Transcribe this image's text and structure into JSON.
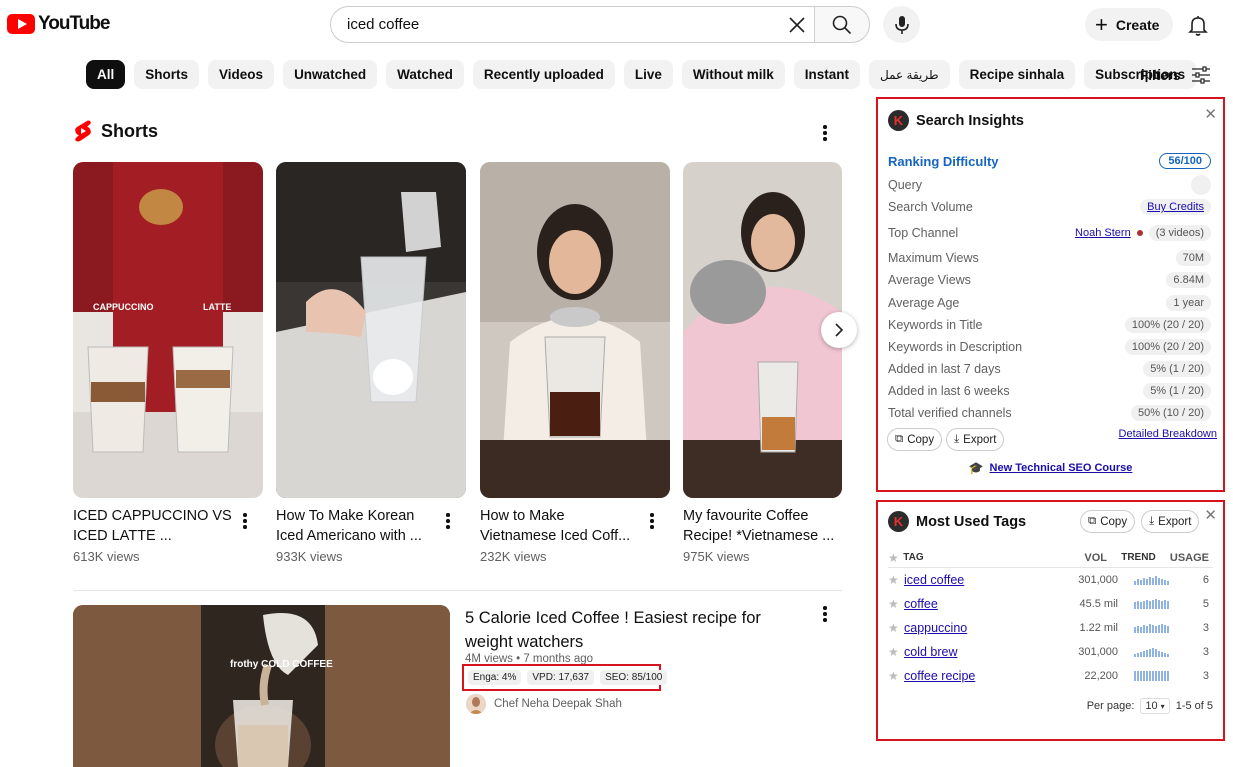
{
  "header": {
    "logo_text": "YouTube",
    "search_value": "iced coffee",
    "create_label": "Create"
  },
  "chips": [
    "All",
    "Shorts",
    "Videos",
    "Unwatched",
    "Watched",
    "Recently uploaded",
    "Live",
    "Without milk",
    "Instant",
    "طريقة عمل",
    "Recipe sinhala",
    "Subscriptions"
  ],
  "filters_label": "Filters",
  "shorts": {
    "heading": "Shorts",
    "items": [
      {
        "title": "ICED CAPPUCCINO VS ICED LATTE ...",
        "views": "613K views"
      },
      {
        "title": "How To Make Korean Iced Americano with ...",
        "views": "933K views"
      },
      {
        "title": "How to Make Vietnamese Iced Coff...",
        "views": "232K views"
      },
      {
        "title": "My favourite Coffee Recipe! *Vietnamese ...",
        "views": "975K views"
      }
    ]
  },
  "video": {
    "title": "5 Calorie Iced Coffee ! Easiest recipe for weight watchers",
    "meta": "4M views • 7 months ago",
    "metrics": [
      "Enga: 4%",
      "VPD: 17,637",
      "SEO: 85/100"
    ],
    "channel": "Chef Neha Deepak Shah",
    "thumb_text": "frothy COLD COFFEE"
  },
  "insights": {
    "title": "Search Insights",
    "ranking_label": "Ranking Difficulty",
    "ranking_value": "56/100",
    "rows": [
      {
        "label": "Query",
        "value": ""
      },
      {
        "label": "Search Volume",
        "value": "Buy Credits"
      },
      {
        "label": "Top Channel",
        "value": "(3 videos)",
        "channel": "Noah Stern"
      },
      {
        "label": "Maximum Views",
        "value": "70M"
      },
      {
        "label": "Average Views",
        "value": "6.84M"
      },
      {
        "label": "Average Age",
        "value": "1 year"
      },
      {
        "label": "Keywords in Title",
        "value": "100% (20 / 20)"
      },
      {
        "label": "Keywords in Description",
        "value": "100% (20 / 20)"
      },
      {
        "label": "Added in last 7 days",
        "value": "5% (1 / 20)"
      },
      {
        "label": "Added in last 6 weeks",
        "value": "5% (1 / 20)"
      },
      {
        "label": "Total verified channels",
        "value": "50% (10 / 20)"
      }
    ],
    "copy_label": "Copy",
    "export_label": "Export",
    "breakdown_label": "Detailed Breakdown",
    "course_label": "New Technical SEO Course"
  },
  "tags": {
    "title": "Most Used Tags",
    "copy_label": "Copy",
    "export_label": "Export",
    "columns": [
      "TAG",
      "VOL",
      "TREND",
      "USAGE"
    ],
    "rows": [
      {
        "tag": "iced coffee",
        "vol": "301,000",
        "usage": "6"
      },
      {
        "tag": "coffee",
        "vol": "45.5 mil",
        "usage": "5"
      },
      {
        "tag": "cappuccino",
        "vol": "1.22 mil",
        "usage": "3"
      },
      {
        "tag": "cold brew",
        "vol": "301,000",
        "usage": "3"
      },
      {
        "tag": "coffee recipe",
        "vol": "22,200",
        "usage": "3"
      }
    ],
    "per_page_label": "Per page:",
    "per_page_value": "10",
    "range": "1-5 of 5"
  }
}
